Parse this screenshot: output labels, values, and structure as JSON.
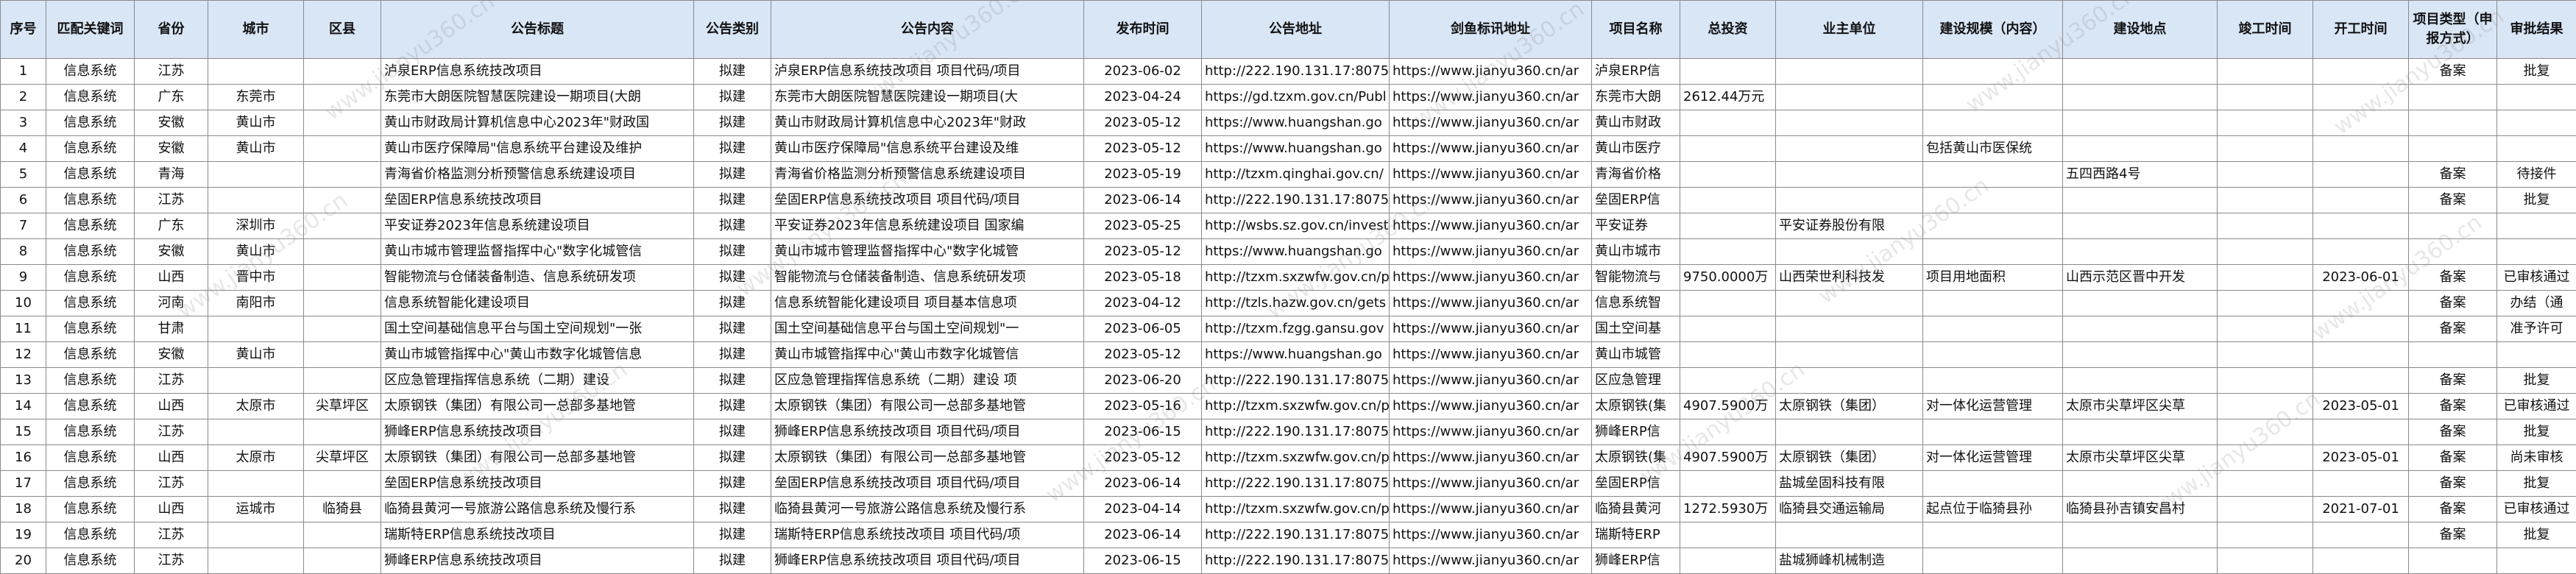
{
  "columns": [
    "序号",
    "匹配关键词",
    "省份",
    "城市",
    "区县",
    "公告标题",
    "公告类别",
    "公告内容",
    "发布时间",
    "公告地址",
    "剑鱼标讯地址",
    "项目名称",
    "总投资",
    "业主单位",
    "建设规模（内容）",
    "建设地点",
    "竣工时间",
    "开工时间",
    "项目类型（申报方式）",
    "审批结果"
  ],
  "watermark_text": "www.jianyu360.cn",
  "rows": [
    [
      "1",
      "信息系统",
      "江苏",
      "",
      "",
      "泸泉ERP信息系统技改项目",
      "拟建",
      "泸泉ERP信息系统技改项目 项目代码/项目",
      "2023-06-02",
      "http://222.190.131.17:8075/",
      "https://www.jianyu360.cn/ar",
      "泸泉ERP信",
      "",
      "",
      "",
      "",
      "",
      "",
      "备案",
      "批复"
    ],
    [
      "2",
      "信息系统",
      "广东",
      "东莞市",
      "",
      "东莞市大朗医院智慧医院建设一期项目(大朗",
      "拟建",
      "东莞市大朗医院智慧医院建设一期项目(大",
      "2023-04-24",
      "https://gd.tzxm.gov.cn/Publ",
      "https://www.jianyu360.cn/ar",
      "东莞市大朗",
      "2612.44万元",
      "",
      "",
      "",
      "",
      "",
      "",
      ""
    ],
    [
      "3",
      "信息系统",
      "安徽",
      "黄山市",
      "",
      "黄山市财政局计算机信息中心2023年\"财政国",
      "拟建",
      "黄山市财政局计算机信息中心2023年\"财政",
      "2023-05-12",
      "https://www.huangshan.go",
      "https://www.jianyu360.cn/ar",
      "黄山市财政",
      "",
      "",
      "",
      "",
      "",
      "",
      "",
      ""
    ],
    [
      "4",
      "信息系统",
      "安徽",
      "黄山市",
      "",
      "黄山市医疗保障局\"信息系统平台建设及维护",
      "拟建",
      "黄山市医疗保障局\"信息系统平台建设及维",
      "2023-05-12",
      "https://www.huangshan.go",
      "https://www.jianyu360.cn/ar",
      "黄山市医疗",
      "",
      "",
      "包括黄山市医保统",
      "",
      "",
      "",
      "",
      ""
    ],
    [
      "5",
      "信息系统",
      "青海",
      "",
      "",
      "青海省价格监测分析预警信息系统建设项目",
      "拟建",
      "青海省价格监测分析预警信息系统建设项目",
      "2023-05-19",
      "http://tzxm.qinghai.gov.cn/",
      "https://www.jianyu360.cn/ar",
      "青海省价格",
      "",
      "",
      "",
      "五四西路4号",
      "",
      "",
      "备案",
      "待接件"
    ],
    [
      "6",
      "信息系统",
      "江苏",
      "",
      "",
      "垒固ERP信息系统技改项目",
      "拟建",
      "垒固ERP信息系统技改项目 项目代码/项目",
      "2023-06-14",
      "http://222.190.131.17:8075/",
      "https://www.jianyu360.cn/ar",
      "垒固ERP信",
      "",
      "",
      "",
      "",
      "",
      "",
      "备案",
      "批复"
    ],
    [
      "7",
      "信息系统",
      "广东",
      "深圳市",
      "",
      "平安证券2023年信息系统建设项目",
      "拟建",
      "平安证券2023年信息系统建设项目 国家编",
      "2023-05-25",
      "http://wsbs.sz.gov.cn/invest",
      "https://www.jianyu360.cn/ar",
      "平安证券",
      "",
      "平安证券股份有限",
      "",
      "",
      "",
      "",
      "",
      ""
    ],
    [
      "8",
      "信息系统",
      "安徽",
      "黄山市",
      "",
      "黄山市城市管理监督指挥中心\"数字化城管信",
      "拟建",
      "黄山市城市管理监督指挥中心\"数字化城管",
      "2023-05-12",
      "https://www.huangshan.go",
      "https://www.jianyu360.cn/ar",
      "黄山市城市",
      "",
      "",
      "",
      "",
      "",
      "",
      "",
      ""
    ],
    [
      "9",
      "信息系统",
      "山西",
      "晋中市",
      "",
      "智能物流与仓储装备制造、信息系统研发项",
      "拟建",
      "智能物流与仓储装备制造、信息系统研发项",
      "2023-05-18",
      "http://tzxm.sxzwfw.gov.cn/p",
      "https://www.jianyu360.cn/ar",
      "智能物流与",
      "9750.0000万",
      "山西荣世利科技发",
      "项目用地面积",
      "山西示范区晋中开发",
      "",
      "2023-06-01",
      "备案",
      "已审核通过"
    ],
    [
      "10",
      "信息系统",
      "河南",
      "南阳市",
      "",
      "信息系统智能化建设项目",
      "拟建",
      "信息系统智能化建设项目 项目基本信息项",
      "2023-04-12",
      "http://tzls.hazw.gov.cn/gets",
      "https://www.jianyu360.cn/ar",
      "信息系统智",
      "",
      "",
      "",
      "",
      "",
      "",
      "备案",
      "办结（通"
    ],
    [
      "11",
      "信息系统",
      "甘肃",
      "",
      "",
      "国土空间基础信息平台与国土空间规划\"一张",
      "拟建",
      "国土空间基础信息平台与国土空间规划\"一",
      "2023-06-05",
      "http://tzxm.fzgg.gansu.gov",
      "https://www.jianyu360.cn/ar",
      "国土空间基",
      "",
      "",
      "",
      "",
      "",
      "",
      "备案",
      "准予许可"
    ],
    [
      "12",
      "信息系统",
      "安徽",
      "黄山市",
      "",
      "黄山市城管指挥中心\"黄山市数字化城管信息",
      "拟建",
      "黄山市城管指挥中心\"黄山市数字化城管信",
      "2023-05-12",
      "https://www.huangshan.go",
      "https://www.jianyu360.cn/ar",
      "黄山市城管",
      "",
      "",
      "",
      "",
      "",
      "",
      "",
      ""
    ],
    [
      "13",
      "信息系统",
      "江苏",
      "",
      "",
      "区应急管理指挥信息系统（二期）建设",
      "拟建",
      "区应急管理指挥信息系统（二期）建设 项",
      "2023-06-20",
      "http://222.190.131.17:8075/",
      "https://www.jianyu360.cn/ar",
      "区应急管理",
      "",
      "",
      "",
      "",
      "",
      "",
      "备案",
      "批复"
    ],
    [
      "14",
      "信息系统",
      "山西",
      "太原市",
      "尖草坪区",
      "太原钢铁（集团）有限公司一总部多基地管",
      "拟建",
      "太原钢铁（集团）有限公司一总部多基地管",
      "2023-05-16",
      "http://tzxm.sxzwfw.gov.cn/p",
      "https://www.jianyu360.cn/ar",
      "太原钢铁(集",
      "4907.5900万",
      "太原钢铁（集团）",
      "对一体化运营管理",
      "太原市尖草坪区尖草",
      "",
      "2023-05-01",
      "备案",
      "已审核通过"
    ],
    [
      "15",
      "信息系统",
      "江苏",
      "",
      "",
      "狮峰ERP信息系统技改项目",
      "拟建",
      "狮峰ERP信息系统技改项目 项目代码/项目",
      "2023-06-15",
      "http://222.190.131.17:8075/",
      "https://www.jianyu360.cn/ar",
      "狮峰ERP信",
      "",
      "",
      "",
      "",
      "",
      "",
      "备案",
      "批复"
    ],
    [
      "16",
      "信息系统",
      "山西",
      "太原市",
      "尖草坪区",
      "太原钢铁（集团）有限公司一总部多基地管",
      "拟建",
      "太原钢铁（集团）有限公司一总部多基地管",
      "2023-05-12",
      "http://tzxm.sxzwfw.gov.cn/p",
      "https://www.jianyu360.cn/ar",
      "太原钢铁(集",
      "4907.5900万",
      "太原钢铁（集团）",
      "对一体化运营管理",
      "太原市尖草坪区尖草",
      "",
      "2023-05-01",
      "备案",
      "尚未审核"
    ],
    [
      "17",
      "信息系统",
      "江苏",
      "",
      "",
      "垒固ERP信息系统技改项目",
      "拟建",
      "垒固ERP信息系统技改项目 项目代码/项目",
      "2023-06-14",
      "http://222.190.131.17:8075/",
      "https://www.jianyu360.cn/ar",
      "垒固ERP信",
      "",
      "盐城垒固科技有限",
      "",
      "",
      "",
      "",
      "备案",
      "批复"
    ],
    [
      "18",
      "信息系统",
      "山西",
      "运城市",
      "临猗县",
      "临猗县黄河一号旅游公路信息系统及慢行系",
      "拟建",
      "临猗县黄河一号旅游公路信息系统及慢行系",
      "2023-04-14",
      "http://tzxm.sxzwfw.gov.cn/p",
      "https://www.jianyu360.cn/ar",
      "临猗县黄河",
      "1272.5930万",
      "临猗县交通运输局",
      "起点位于临猗县孙",
      "临猗县孙吉镇安昌村",
      "",
      "2021-07-01",
      "备案",
      "已审核通过"
    ],
    [
      "19",
      "信息系统",
      "江苏",
      "",
      "",
      "瑞斯特ERP信息系统技改项目",
      "拟建",
      "瑞斯特ERP信息系统技改项目 项目代码/项",
      "2023-06-14",
      "http://222.190.131.17:8075/",
      "https://www.jianyu360.cn/ar",
      "瑞斯特ERP",
      "",
      "",
      "",
      "",
      "",
      "",
      "备案",
      "批复"
    ],
    [
      "20",
      "信息系统",
      "江苏",
      "",
      "",
      "狮峰ERP信息系统技改项目",
      "拟建",
      "狮峰ERP信息系统技改项目 项目代码/项目",
      "2023-06-15",
      "http://222.190.131.17:8075/",
      "https://www.jianyu360.cn/ar",
      "狮峰ERP信",
      "",
      "盐城狮峰机械制造",
      "",
      "",
      "",
      "",
      "",
      ""
    ]
  ]
}
